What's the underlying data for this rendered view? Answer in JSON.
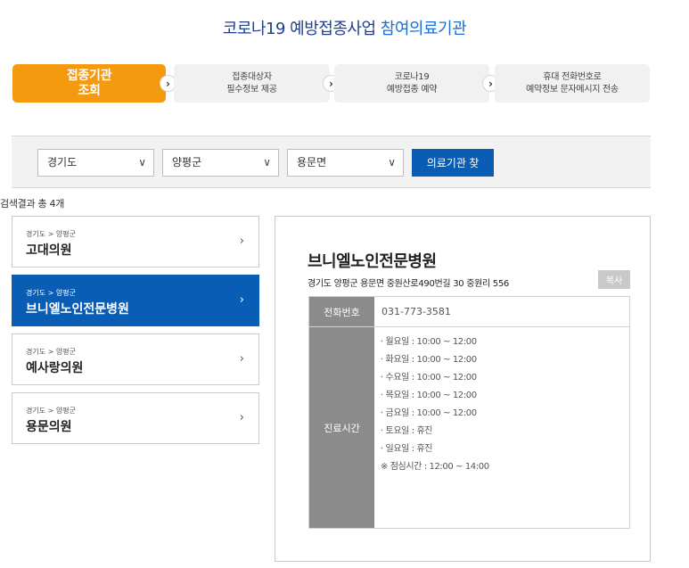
{
  "page_title": {
    "part1": "코로나19 예방접종사업 ",
    "part2": "참여의료기관"
  },
  "steps": [
    {
      "line1": "접종기관",
      "line2": "조회",
      "active": true
    },
    {
      "line1": "접종대상자",
      "line2": "필수정보 제공",
      "active": false
    },
    {
      "line1": "코로나19",
      "line2": "예방접종 예약",
      "active": false
    },
    {
      "line1": "휴대 전화번호로",
      "line2": "예약정보 문자메시지 전송",
      "active": false
    }
  ],
  "step_arrow": "›",
  "search": {
    "province": "경기도",
    "county": "양평군",
    "town": "용문면",
    "chevron": "∨",
    "button_label": "의료기관 찾"
  },
  "result_count": "검색결과 총 4개",
  "results": [
    {
      "breadcrumb": "경기도 > 양평군",
      "name": "고대의원"
    },
    {
      "breadcrumb": "경기도 > 양평군",
      "name": "브니엘노인전문병원"
    },
    {
      "breadcrumb": "경기도 > 양평군",
      "name": "예사랑의원"
    },
    {
      "breadcrumb": "경기도 > 양평군",
      "name": "용문의원"
    }
  ],
  "list_chevron": "›",
  "detail": {
    "name": "브니엘노인전문병원",
    "address": "경기도 양평군 용문면 중원산로490번길 30 중원리 556",
    "copy_label": "복사",
    "phone_label": "전화번호",
    "phone": "031-773-3581",
    "hours_label": "진료시간",
    "hours": [
      "· 월요일 : 10:00 ~ 12:00",
      "· 화요일 : 10:00 ~ 12:00",
      "· 수요일 : 10:00 ~ 12:00",
      "· 목요일 : 10:00 ~ 12:00",
      "· 금요일 : 10:00 ~ 12:00",
      "· 토요일 : 휴진",
      "· 일요일 : 휴진",
      "※ 점심시간 : 12:00 ~ 14:00"
    ]
  },
  "colors": {
    "accent_orange": "#f59a0e",
    "primary_blue": "#0a5db5",
    "title_navy": "#1f3f8a",
    "table_label_gray": "#8b8b8b"
  }
}
